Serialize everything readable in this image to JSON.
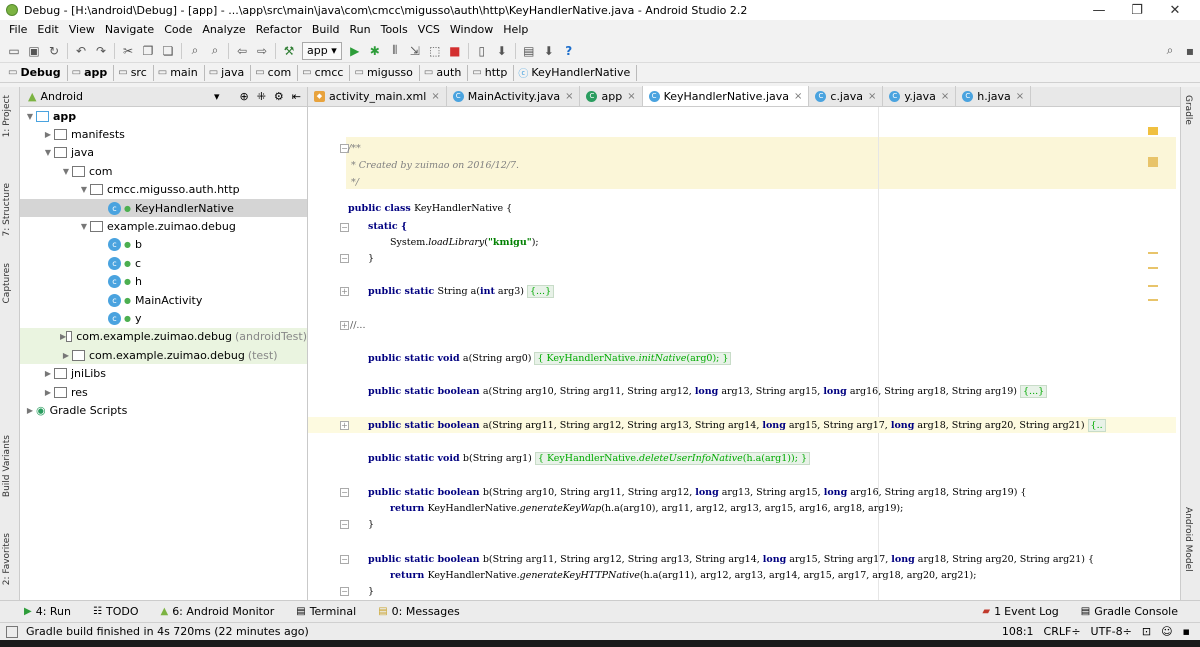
{
  "window": {
    "title": "Debug - [H:\\android\\Debug] - [app] - ...\\app\\src\\main\\java\\com\\cmcc\\migusso\\auth\\http\\KeyHandlerNative.java - Android Studio 2.2",
    "minimize": "—",
    "maximize": "❐",
    "close": "✕"
  },
  "menu": [
    "File",
    "Edit",
    "View",
    "Navigate",
    "Code",
    "Analyze",
    "Refactor",
    "Build",
    "Run",
    "Tools",
    "VCS",
    "Window",
    "Help"
  ],
  "toolbar": {
    "run_config": "app"
  },
  "breadcrumb": [
    "Debug",
    "app",
    "src",
    "main",
    "java",
    "com",
    "cmcc",
    "migusso",
    "auth",
    "http",
    "KeyHandlerNative"
  ],
  "left_tools": [
    "1: Project",
    "7: Structure",
    "Captures",
    "Build Variants",
    "2: Favorites"
  ],
  "right_tools": [
    "Gradle",
    "Android Model"
  ],
  "project": {
    "view": "Android",
    "tree": [
      {
        "label": "app",
        "depth": 0,
        "kind": "module",
        "expanded": true,
        "bold": true
      },
      {
        "label": "manifests",
        "depth": 1,
        "kind": "folder",
        "expanded": false
      },
      {
        "label": "java",
        "depth": 1,
        "kind": "folder",
        "expanded": true
      },
      {
        "label": "com",
        "depth": 2,
        "kind": "package",
        "expanded": true
      },
      {
        "label": "cmcc.migusso.auth.http",
        "depth": 3,
        "kind": "package",
        "expanded": true
      },
      {
        "label": "KeyHandlerNative",
        "depth": 4,
        "kind": "class",
        "selected": true
      },
      {
        "label": "example.zuimao.debug",
        "depth": 3,
        "kind": "package",
        "expanded": true
      },
      {
        "label": "b",
        "depth": 4,
        "kind": "class"
      },
      {
        "label": "c",
        "depth": 4,
        "kind": "class"
      },
      {
        "label": "h",
        "depth": 4,
        "kind": "class"
      },
      {
        "label": "MainActivity",
        "depth": 4,
        "kind": "class"
      },
      {
        "label": "y",
        "depth": 4,
        "kind": "class"
      },
      {
        "label": "com.example.zuimao.debug",
        "suffix": "(androidTest)",
        "depth": 2,
        "kind": "package",
        "expanded": false,
        "test": true
      },
      {
        "label": "com.example.zuimao.debug",
        "suffix": "(test)",
        "depth": 2,
        "kind": "package",
        "expanded": false,
        "test": true
      },
      {
        "label": "jniLibs",
        "depth": 1,
        "kind": "folder",
        "expanded": false
      },
      {
        "label": "res",
        "depth": 1,
        "kind": "folder",
        "expanded": false
      },
      {
        "label": "Gradle Scripts",
        "depth": 0,
        "kind": "gradle",
        "expanded": false
      }
    ]
  },
  "tabs": [
    {
      "label": "activity_main.xml",
      "icon": "xml"
    },
    {
      "label": "MainActivity.java",
      "icon": "class"
    },
    {
      "label": "app",
      "icon": "app"
    },
    {
      "label": "KeyHandlerNative.java",
      "icon": "class",
      "active": true
    },
    {
      "label": "c.java",
      "icon": "class"
    },
    {
      "label": "y.java",
      "icon": "class"
    },
    {
      "label": "h.java",
      "icon": "class"
    }
  ],
  "code": {
    "doc_open": "/**",
    "doc_line": " * Created by zuimao on 2016/12/7.",
    "doc_close": " */",
    "l_class_kw": "public class ",
    "l_class_name": "KeyHandlerNative {",
    "l_static": "static {",
    "l_load_a": "System.",
    "l_load_b": "loadLibrary",
    "l_load_c": "(",
    "l_load_str": "\"kmigu\"",
    "l_load_d": ");",
    "l_close": "}",
    "l1_kw": "public static ",
    "l1_rest": "String a(",
    "l1_int": "int",
    "l1_tail": " arg3) ",
    "fold": "{...}",
    "l2": "//...",
    "l3_kw": "public static void ",
    "l3_rest": "a(String arg0) ",
    "l3_body_a": "{ KeyHandlerNative.",
    "l3_body_b": "initNative",
    "l3_body_c": "(arg0); }",
    "l4_kw": "public static boolean ",
    "l4_rest": "a(String arg10, String arg11, String arg12, ",
    "long": "long",
    "l4_rest2": " arg13, String arg15, ",
    "l4_rest3": " arg16, String arg18, String arg19) ",
    "l5_rest": "a(String arg11, String arg12, String arg13, String arg14, ",
    "l5_rest2": " arg15, String arg17, ",
    "l5_rest3": " arg18, String arg20, String arg21) ",
    "l5_fold": "{..",
    "l6_rest": "b(String arg1) ",
    "l6_body_a": "{ KeyHandlerNative.",
    "l6_body_b": "deleteUserInfoNative",
    "l6_body_c": "(h.a(arg1)); }",
    "l7_rest": "b(String arg10, String arg11, String arg12, ",
    "l7_rest3": " arg16, String arg18, String arg19) {",
    "ret_kw": "return ",
    "l7_ret_a": "KeyHandlerNative.",
    "l7_ret_b": "generateKeyWap",
    "l7_ret_c": "(h.a(arg10), arg11, arg12, arg13, arg15, arg16, arg18, arg19);",
    "l8_rest": "b(String arg11, String arg12, String arg13, String arg14, ",
    "l8_rest3": " arg18, String arg20, String arg21) {",
    "l8_ret_b": "generateKeyHTTPNative",
    "l8_ret_c": "(h.a(arg11), arg12, arg13, arg14, arg15, arg17, arg18, arg20, arg21);"
  },
  "bottom_tools": {
    "run": "4: Run",
    "todo": "TODO",
    "monitor": "6: Android Monitor",
    "terminal": "Terminal",
    "messages": "0: Messages",
    "event_log": "Event Log",
    "event_count": "1",
    "gradle_console": "Gradle Console"
  },
  "status": {
    "message": "Gradle build finished in 4s 720ms (22 minutes ago)",
    "position": "108:1",
    "line_sep": "CRLF÷",
    "encoding": "UTF-8÷"
  },
  "colors": {
    "keyword": "#000080",
    "string": "#008000",
    "doc_band": "#fbf6d8",
    "selection": "#d5d5d5"
  }
}
